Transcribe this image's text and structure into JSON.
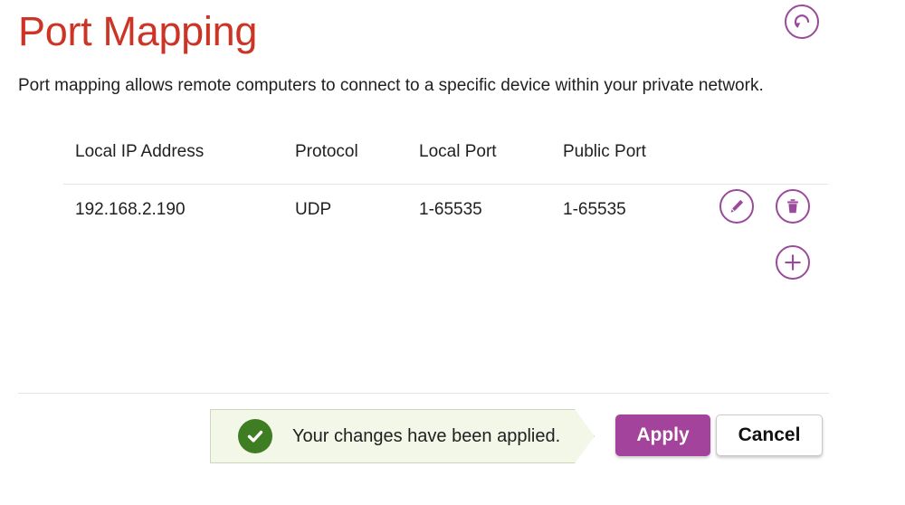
{
  "header": {
    "title": "Port Mapping",
    "title_color": "#cc3525",
    "description": "Port mapping allows remote computers to connect to a specific device within your private network.",
    "reset_icon": "refresh-circular-arrow-icon"
  },
  "table": {
    "columns": [
      "Local IP Address",
      "Protocol",
      "Local Port",
      "Public Port"
    ],
    "rows": [
      {
        "local_ip": "192.168.2.190",
        "protocol": "UDP",
        "local_port": "1-65535",
        "public_port": "1-65535",
        "edit_icon": "pencil-icon",
        "delete_icon": "trash-icon"
      }
    ],
    "add_icon": "plus-icon"
  },
  "footer": {
    "status": {
      "message": "Your changes have been applied.",
      "icon": "check-circle-icon",
      "icon_color": "#3f7d22",
      "background": "#f3f7e8"
    },
    "apply_label": "Apply",
    "cancel_label": "Cancel",
    "accent_color": "#a3439b"
  }
}
